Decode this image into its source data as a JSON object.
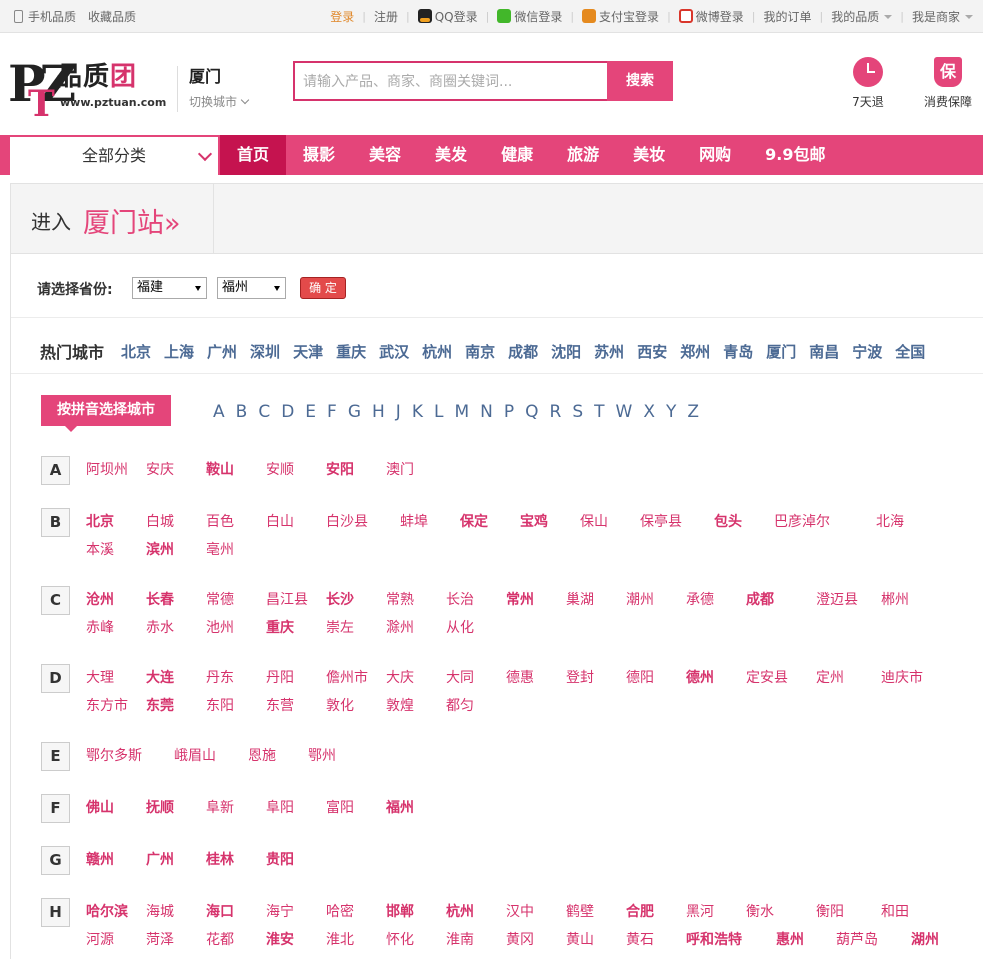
{
  "topbar": {
    "mobile": "手机品质",
    "favorite": "收藏品质",
    "login": "登录",
    "register": "注册",
    "qq_login": "QQ登录",
    "wechat_login": "微信登录",
    "alipay_login": "支付宝登录",
    "weibo_login": "微博登录",
    "my_orders": "我的订单",
    "my_pinzhi": "我的品质",
    "merchant": "我是商家"
  },
  "logo": {
    "pz": "PZ",
    "t": "T",
    "cn_pin": "品质",
    "cn_tuan": "团",
    "url": "www.pztuan.com"
  },
  "city": {
    "name": "厦门",
    "switch": "切换城市"
  },
  "search": {
    "placeholder": "请输入产品、商家、商圈关键词...",
    "button": "搜索"
  },
  "promises": [
    {
      "label": "7天退",
      "icon": "clock-icon"
    },
    {
      "label": "消费保障",
      "icon": "shield-icon",
      "glyph": "保"
    }
  ],
  "nav": {
    "all_categories": "全部分类",
    "items": [
      "首页",
      "摄影",
      "美容",
      "美发",
      "健康",
      "旅游",
      "美妆",
      "网购",
      "9.9包邮"
    ]
  },
  "enter": {
    "prefix": "进入",
    "station": "厦门站»"
  },
  "province": {
    "label": "请选择省份:",
    "province_value": "福建",
    "city_value": "福州",
    "confirm": "确 定"
  },
  "hot": {
    "label": "热门城市",
    "cities": [
      "北京",
      "上海",
      "广州",
      "深圳",
      "天津",
      "重庆",
      "武汉",
      "杭州",
      "南京",
      "成都",
      "沈阳",
      "苏州",
      "西安",
      "郑州",
      "青岛",
      "厦门",
      "南昌",
      "宁波",
      "全国"
    ]
  },
  "pinyin": {
    "label": "按拼音选择城市",
    "letters": [
      "A",
      "B",
      "C",
      "D",
      "E",
      "F",
      "G",
      "H",
      "J",
      "K",
      "L",
      "M",
      "N",
      "P",
      "Q",
      "R",
      "S",
      "T",
      "W",
      "X",
      "Y",
      "Z"
    ]
  },
  "groups": [
    {
      "letter": "A",
      "rows": [
        [
          {
            "n": "阿坝州",
            "b": false
          },
          {
            "n": "安庆",
            "b": false
          },
          {
            "n": "鞍山",
            "b": true
          },
          {
            "n": "安顺",
            "b": false
          },
          {
            "n": "安阳",
            "b": true
          },
          {
            "n": "澳门",
            "b": false
          }
        ]
      ]
    },
    {
      "letter": "B",
      "rows": [
        [
          {
            "n": "北京",
            "b": true
          },
          {
            "n": "白城",
            "b": false
          },
          {
            "n": "百色",
            "b": false
          },
          {
            "n": "白山",
            "b": false
          },
          {
            "n": "白沙县",
            "b": false
          },
          {
            "n": "蚌埠",
            "b": false
          },
          {
            "n": "保定",
            "b": true
          },
          {
            "n": "宝鸡",
            "b": true
          },
          {
            "n": "保山",
            "b": false
          },
          {
            "n": "保亭县",
            "b": false
          },
          {
            "n": "包头",
            "b": true
          },
          {
            "n": "巴彦淖尔",
            "b": false
          },
          {
            "n": "北海",
            "b": false
          }
        ],
        [
          {
            "n": "本溪",
            "b": false
          },
          {
            "n": "滨州",
            "b": true
          },
          {
            "n": "亳州",
            "b": false
          }
        ]
      ]
    },
    {
      "letter": "C",
      "rows": [
        [
          {
            "n": "沧州",
            "b": true
          },
          {
            "n": "长春",
            "b": true
          },
          {
            "n": "常德",
            "b": false
          },
          {
            "n": "昌江县",
            "b": false
          },
          {
            "n": "长沙",
            "b": true
          },
          {
            "n": "常熟",
            "b": false
          },
          {
            "n": "长治",
            "b": false
          },
          {
            "n": "常州",
            "b": true
          },
          {
            "n": "巢湖",
            "b": false
          },
          {
            "n": "潮州",
            "b": false
          },
          {
            "n": "承德",
            "b": false
          },
          {
            "n": "成都",
            "b": true
          },
          {
            "n": "澄迈县",
            "b": false
          },
          {
            "n": "郴州",
            "b": false
          }
        ],
        [
          {
            "n": "赤峰",
            "b": false
          },
          {
            "n": "赤水",
            "b": false
          },
          {
            "n": "池州",
            "b": false
          },
          {
            "n": "重庆",
            "b": true
          },
          {
            "n": "崇左",
            "b": false
          },
          {
            "n": "滁州",
            "b": false
          },
          {
            "n": "从化",
            "b": false
          }
        ]
      ]
    },
    {
      "letter": "D",
      "rows": [
        [
          {
            "n": "大理",
            "b": false
          },
          {
            "n": "大连",
            "b": true
          },
          {
            "n": "丹东",
            "b": false
          },
          {
            "n": "丹阳",
            "b": false
          },
          {
            "n": "儋州市",
            "b": false
          },
          {
            "n": "大庆",
            "b": false
          },
          {
            "n": "大同",
            "b": false
          },
          {
            "n": "德惠",
            "b": false
          },
          {
            "n": "登封",
            "b": false
          },
          {
            "n": "德阳",
            "b": false
          },
          {
            "n": "德州",
            "b": true
          },
          {
            "n": "定安县",
            "b": false
          },
          {
            "n": "定州",
            "b": false
          },
          {
            "n": "迪庆市",
            "b": false
          }
        ],
        [
          {
            "n": "东方市",
            "b": false
          },
          {
            "n": "东莞",
            "b": true
          },
          {
            "n": "东阳",
            "b": false
          },
          {
            "n": "东营",
            "b": false
          },
          {
            "n": "敦化",
            "b": false
          },
          {
            "n": "敦煌",
            "b": false
          },
          {
            "n": "都匀",
            "b": false
          }
        ]
      ]
    },
    {
      "letter": "E",
      "rows": [
        [
          {
            "n": "鄂尔多斯",
            "b": false
          },
          {
            "n": "峨眉山",
            "b": false
          },
          {
            "n": "恩施",
            "b": false
          },
          {
            "n": "鄂州",
            "b": false
          }
        ]
      ]
    },
    {
      "letter": "F",
      "rows": [
        [
          {
            "n": "佛山",
            "b": true
          },
          {
            "n": "抚顺",
            "b": true
          },
          {
            "n": "阜新",
            "b": false
          },
          {
            "n": "阜阳",
            "b": false
          },
          {
            "n": "富阳",
            "b": false
          },
          {
            "n": "福州",
            "b": true
          }
        ]
      ]
    },
    {
      "letter": "G",
      "rows": [
        [
          {
            "n": "赣州",
            "b": true
          },
          {
            "n": "广州",
            "b": true
          },
          {
            "n": "桂林",
            "b": true
          },
          {
            "n": "贵阳",
            "b": true
          }
        ]
      ]
    },
    {
      "letter": "H",
      "rows": [
        [
          {
            "n": "哈尔滨",
            "b": true
          },
          {
            "n": "海城",
            "b": false
          },
          {
            "n": "海口",
            "b": true
          },
          {
            "n": "海宁",
            "b": false
          },
          {
            "n": "哈密",
            "b": false
          },
          {
            "n": "邯郸",
            "b": true
          },
          {
            "n": "杭州",
            "b": true
          },
          {
            "n": "汉中",
            "b": false
          },
          {
            "n": "鹤壁",
            "b": false
          },
          {
            "n": "合肥",
            "b": true
          },
          {
            "n": "黑河",
            "b": false
          },
          {
            "n": "衡水",
            "b": false
          },
          {
            "n": "衡阳",
            "b": false
          },
          {
            "n": "和田",
            "b": false
          }
        ],
        [
          {
            "n": "河源",
            "b": false
          },
          {
            "n": "菏泽",
            "b": false
          },
          {
            "n": "花都",
            "b": false
          },
          {
            "n": "淮安",
            "b": true
          },
          {
            "n": "淮北",
            "b": false
          },
          {
            "n": "怀化",
            "b": false
          },
          {
            "n": "淮南",
            "b": false
          },
          {
            "n": "黄冈",
            "b": false
          },
          {
            "n": "黄山",
            "b": false
          },
          {
            "n": "黄石",
            "b": false
          },
          {
            "n": "呼和浩特",
            "b": true
          },
          {
            "n": "惠州",
            "b": true
          },
          {
            "n": "葫芦岛",
            "b": false
          },
          {
            "n": "湖州",
            "b": true
          }
        ]
      ]
    }
  ]
}
